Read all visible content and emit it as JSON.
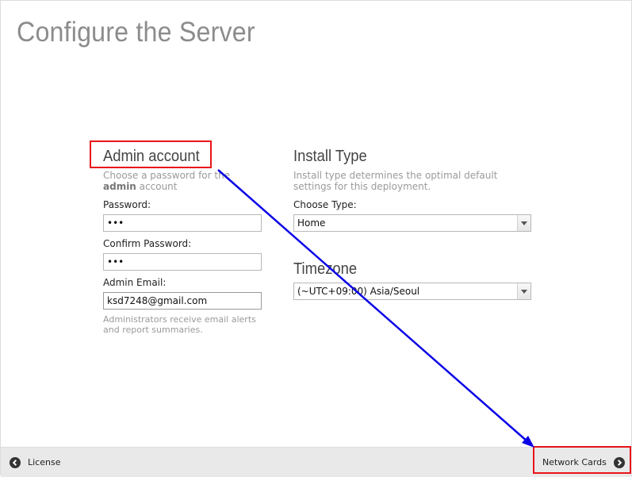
{
  "page": {
    "title": "Configure the Server"
  },
  "admin_account": {
    "title": "Admin account",
    "desc_line1": "Choose a password for the",
    "desc_bold": "admin",
    "desc_rest": " account",
    "password_label": "Password:",
    "password_value": "•••",
    "confirm_label": "Confirm Password:",
    "confirm_value": "•••",
    "email_label": "Admin Email:",
    "email_value": "ksd7248@gmail.com",
    "email_hint": "Administrators receive email alerts and report summaries."
  },
  "install_type": {
    "title": "Install Type",
    "desc": "Install type determines the optimal default settings for this deployment.",
    "choose_label": "Choose Type:",
    "selected": "Home"
  },
  "timezone": {
    "title": "Timezone",
    "selected": "(~UTC+09:00) Asia/Seoul"
  },
  "footer": {
    "back_label": "License",
    "next_label": "Network Cards"
  },
  "colors": {
    "annotation_red": "#e8141b",
    "annotation_arrow": "#0a00e6"
  }
}
